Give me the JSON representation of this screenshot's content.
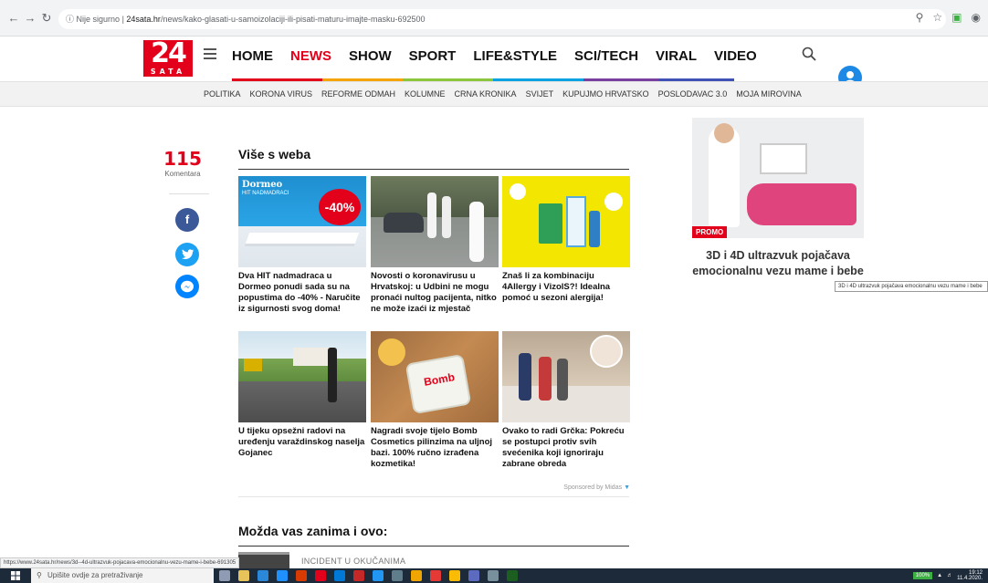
{
  "browser": {
    "security": "Nije sigurno",
    "url_host": "24sata.hr",
    "url_path": "/news/kako-glasati-u-samoizolaciji-ili-pisati-maturu-imajte-masku-692500"
  },
  "site": {
    "logo_number": "24",
    "logo_word": "SATA",
    "main_nav": [
      "HOME",
      "NEWS",
      "SHOW",
      "SPORT",
      "LIFE&STYLE",
      "SCI/TECH",
      "VIRAL",
      "VIDEO"
    ],
    "sub_nav": [
      "POLITIKA",
      "KORONA VIRUS",
      "REFORME ODMAH",
      "KOLUMNE",
      "CRNA KRONIKA",
      "SVIJET",
      "KUPUJMO HRVATSKO",
      "POSLODAVAC 3.0",
      "MOJA MIROVINA"
    ]
  },
  "comments": {
    "count": "115",
    "label": "Komentara"
  },
  "more_from_web": {
    "title": "Više s weba",
    "cards": [
      {
        "caption": "Dva HIT nadmadraca u Dormeo ponudi sada su na popustima do -40% - Naručite iz sigurnosti svog doma!",
        "thumb_brand": "Dormeo",
        "thumb_sub": "HIT NADMADRACI",
        "thumb_badge": "-40%"
      },
      {
        "caption": "Novosti o koronavirusu u Hrvatskoj: u Udbini ne mogu pronaći nultog pacijenta, nitko ne može izaći iz mjestač"
      },
      {
        "caption": "Znaš li za kombinaciju 4Allergy i VizolS?! Idealna pomoć u sezoni alergija!"
      },
      {
        "caption": "U tijeku opsežni radovi na uređenju varaždinskog naselja Gojanec"
      },
      {
        "caption": "Nagradi svoje tijelo Bomb Cosmetics pilinzima na uljnoj bazi. 100% ručno izrađena kozmetika!",
        "thumb_brand": "Bomb"
      },
      {
        "caption": "Ovako to radi Grčka: Pokreću se postupci protiv svih svećenika koji ignoriraju zabrane obreda"
      }
    ],
    "sponsored": "Sponsored by Midas"
  },
  "maybe_interested": {
    "title": "Možda vas zanima i ovo:",
    "item_label": "INCIDENT U OKUČANIMA"
  },
  "promo": {
    "badge": "PROMO",
    "title": "3D i 4D ultrazvuk pojačava emocionalnu vezu mame i bebe",
    "tooltip": "3D i 4D ultrazvuk pojačava emocionalnu vezu mame i bebe"
  },
  "status_url": "https://www.24sata.hr/news/3d--4d-ultrazvuk-pojacava-emocionalnu-vezu-mame-i-bebe-691305",
  "taskbar": {
    "search_placeholder": "Upišite ovdje za pretraživanje",
    "battery": "100%",
    "time": "19:12",
    "date": "11.4.2020."
  },
  "colors": {
    "brand": "#e2001a",
    "facebook": "#3b5998",
    "twitter": "#1da1f2",
    "messenger": "#0084ff",
    "user": "#1e88e5"
  }
}
